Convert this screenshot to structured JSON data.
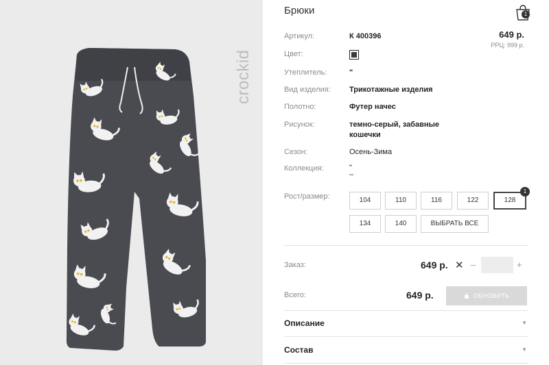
{
  "brand": {
    "logo_text": "crockid"
  },
  "product": {
    "title": "Брюки",
    "cart_count": "1",
    "price": "649 р.",
    "rrp": "РРЦ: 999 р."
  },
  "attributes": [
    {
      "label": "Артикул:",
      "value": "К 400396"
    },
    {
      "label": "Цвет:",
      "value": ""
    },
    {
      "label": "Утеплитель:",
      "value": "\""
    },
    {
      "label": "Вид изделия:",
      "value": "Трикотажные изделия"
    },
    {
      "label": "Полотно:",
      "value": "Футер начес"
    },
    {
      "label": "Рисунок:",
      "value_line1": "темно-серый, забавные",
      "value_line2": "кошечки"
    },
    {
      "label": "Сезон:",
      "value": "Осень-Зима"
    },
    {
      "label": "Коллекция:",
      "value_line1": "\"",
      "value_line2": "–"
    }
  ],
  "colors": {
    "swatch": "#3a3a3a",
    "panel_bg": "#ebebeb",
    "button_disabled": "#d9d9d9"
  },
  "sizes": {
    "label": "Рост/размер:",
    "options": [
      "104",
      "110",
      "116",
      "122",
      "128",
      "134",
      "140"
    ],
    "selected": "128",
    "selected_count": "1",
    "select_all": "ВЫБРАТЬ ВСЕ"
  },
  "order": {
    "label": "Заказ:",
    "price": "649 р.",
    "times": "✕",
    "minus": "–",
    "plus": "+"
  },
  "total": {
    "label": "Всего:",
    "price": "649 р.",
    "button": "ОБНОВИТЬ"
  },
  "sections": [
    {
      "title": "Описание",
      "caret": "▼"
    },
    {
      "title": "Состав",
      "caret": "▼"
    }
  ]
}
